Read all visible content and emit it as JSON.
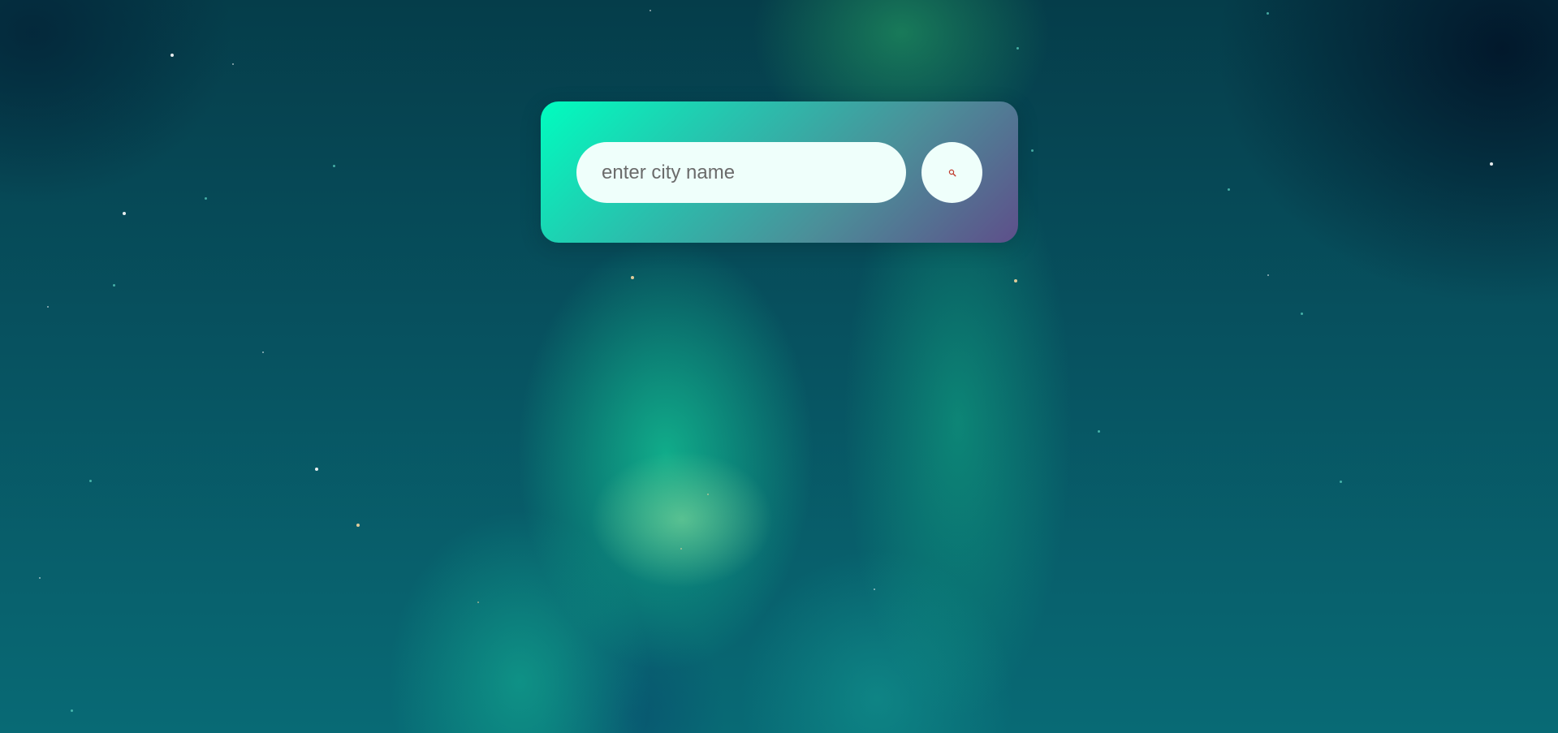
{
  "search": {
    "placeholder": "enter city name",
    "value": "",
    "button_icon": "search-icon"
  },
  "colors": {
    "card_gradient_start": "#00fdbf",
    "card_gradient_end": "#5e4f8a",
    "input_background": "#effffb",
    "icon_color": "#c0392b"
  }
}
